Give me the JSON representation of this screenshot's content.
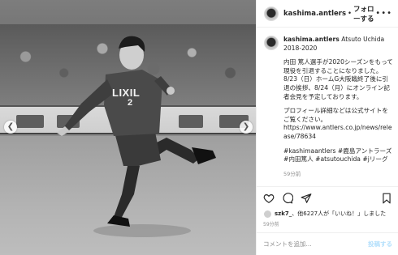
{
  "post": {
    "username": "kashima.antlers",
    "dot": "•",
    "follow_label": "フォローする",
    "more_icon": "more-horizontal-icon"
  },
  "caption": {
    "username": "kashima.antlers",
    "line1": "Atsuto Uchida",
    "line2": "2018-2020",
    "para1": "内田 篤人選手が2020シーズンをもって現役を引退することになりました。8/23（日）ホームG大阪戦終了後に引退の挨拶、8/24（月）にオンライン記者会見を予定しております。",
    "para2": "プロフィール詳細などは公式サイトをご覧ください。",
    "link": "https://www.antlers.co.jp/news/release/78634",
    "tags": "#kashimaantlers #鹿島アントラーズ #内田篤人 #atsutouchida #jリーグ",
    "time": "59分前"
  },
  "photo": {
    "jersey_text": "LIXIL",
    "jersey_number": "2"
  },
  "actions": {
    "like_icon": "heart-icon",
    "comment_icon": "comment-icon",
    "share_icon": "share-icon",
    "save_icon": "bookmark-icon"
  },
  "likes": {
    "user": "szk7_",
    "text": "、他6227人が「いいね！」しました"
  },
  "posted_time": "59分前",
  "comment": {
    "placeholder": "コメントを追加...",
    "post_label": "投稿する"
  }
}
